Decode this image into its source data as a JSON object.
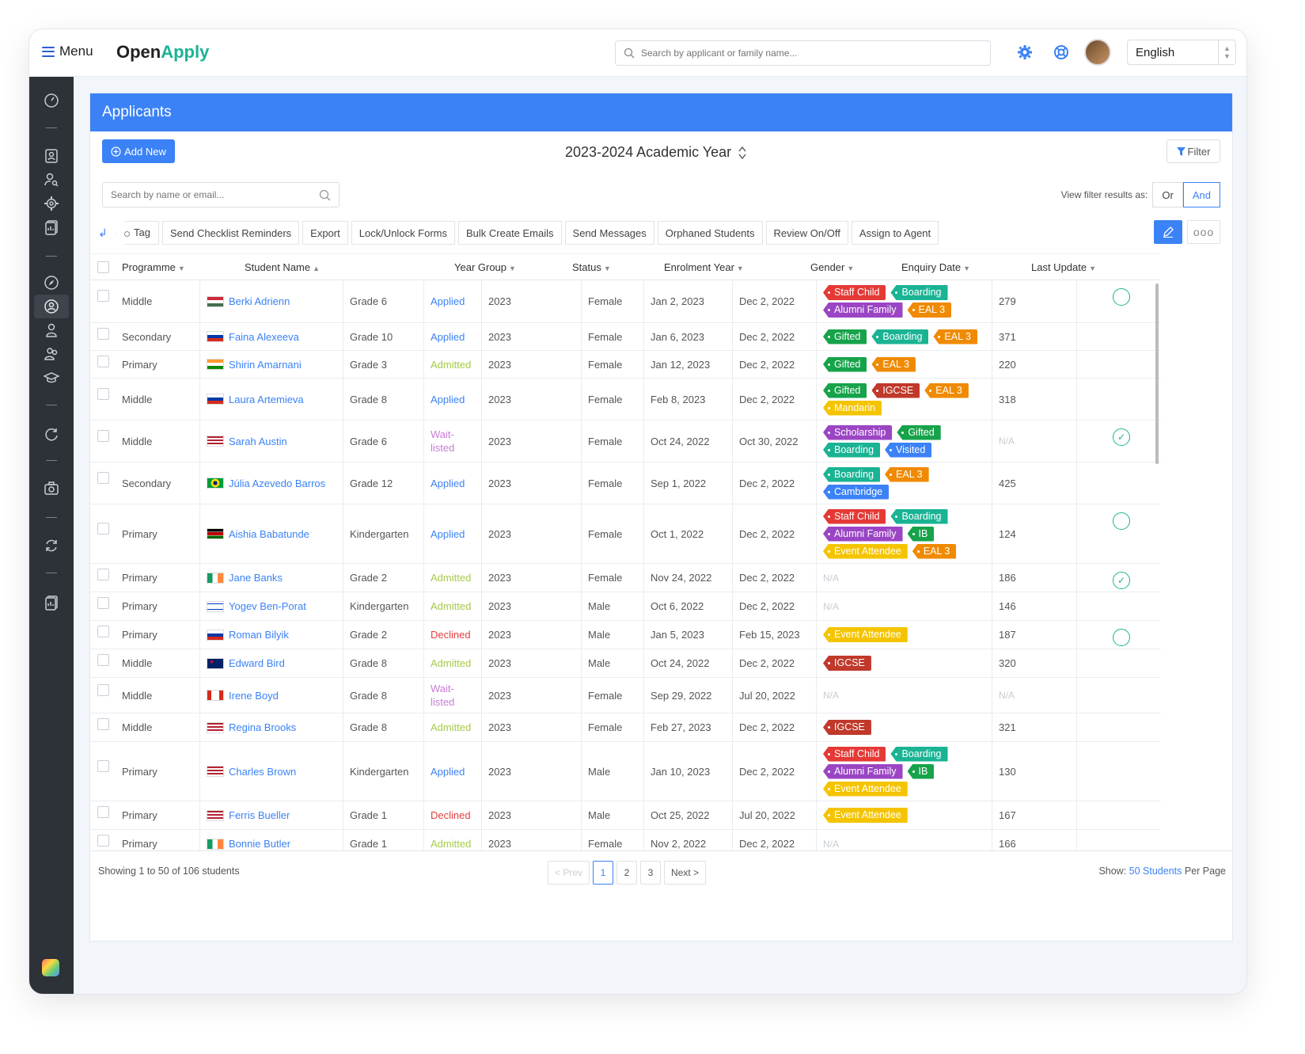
{
  "app": {
    "menu_label": "Menu",
    "logo_part1": "Open",
    "logo_part2": "Apply",
    "search_placeholder": "Search by applicant or family name...",
    "language": "English",
    "icons": [
      "gear-icon",
      "help-icon",
      "avatar"
    ]
  },
  "sidebar": {
    "icons": [
      "dashboard-icon",
      "contacts-icon",
      "user-search-icon",
      "settings-icon",
      "reports-icon",
      "compass-icon",
      "applicants-icon",
      "person-icon",
      "group-icon",
      "graduation-icon",
      "refresh-icon",
      "camera-icon",
      "sync-icon",
      "documents-icon"
    ]
  },
  "page": {
    "title": "Applicants",
    "add_new": "Add New",
    "academic_year": "2023-2024 Academic Year",
    "filter": "Filter",
    "name_search_placeholder": "Search by name or email...",
    "view_filter_label": "View filter results as:",
    "view_or": "Or",
    "view_and": "And"
  },
  "toolbar": {
    "tag": "Tag",
    "buttons": [
      "Send Checklist Reminders",
      "Export",
      "Lock/Unlock Forms",
      "Bulk Create Emails",
      "Send Messages",
      "Orphaned Students",
      "Review On/Off",
      "Assign to Agent"
    ],
    "more": "ooo"
  },
  "columns": [
    "Programme",
    "Student Name",
    "Year Group",
    "Status",
    "Enrolment Year",
    "Gender",
    "Enquiry Date",
    "Last Update"
  ],
  "colors": {
    "accent": "#3b82f6",
    "applied": "#3b82f6",
    "admitted": "#a6c94a",
    "waitlisted": "#c77dd6",
    "declined": "#e53e3e",
    "tag_red": "#e53935",
    "tag_teal": "#1ab394",
    "tag_purple": "#9b45c4",
    "tag_orange": "#f08a00",
    "tag_green": "#16a34a",
    "tag_darkred": "#c0392b",
    "tag_yellow": "#f5c400",
    "tag_blue": "#3b82f6"
  },
  "rows": [
    {
      "programme": "Middle",
      "name": "Berki Adrienn",
      "flag": "hu",
      "grade": "Grade 6",
      "status": "Applied",
      "status_key": "applied",
      "year": "2023",
      "gender": "Female",
      "enquiry": "Jan 2, 2023",
      "last_update": "Dec 2, 2022",
      "tags": [
        {
          "label": "Staff Child",
          "c": "tag_red"
        },
        {
          "label": "Boarding",
          "c": "tag_teal"
        },
        {
          "label": "Alumni Family",
          "c": "tag_purple"
        },
        {
          "label": "EAL 3",
          "c": "tag_orange"
        }
      ],
      "score": "279",
      "check": "empty"
    },
    {
      "programme": "Secondary",
      "name": "Faina Alexeeva",
      "flag": "ru",
      "grade": "Grade 10",
      "status": "Applied",
      "status_key": "applied",
      "year": "2023",
      "gender": "Female",
      "enquiry": "Jan 6, 2023",
      "last_update": "Dec 2, 2022",
      "tags": [
        {
          "label": "Gifted",
          "c": "tag_green"
        },
        {
          "label": "Boarding",
          "c": "tag_teal"
        },
        {
          "label": "EAL 3",
          "c": "tag_orange"
        }
      ],
      "score": "371",
      "check": ""
    },
    {
      "programme": "Primary",
      "name": "Shirin Amarnani",
      "flag": "in",
      "grade": "Grade 3",
      "status": "Admitted",
      "status_key": "admitted",
      "year": "2023",
      "gender": "Female",
      "enquiry": "Jan 12, 2023",
      "last_update": "Dec 2, 2022",
      "tags": [
        {
          "label": "Gifted",
          "c": "tag_green"
        },
        {
          "label": "EAL 3",
          "c": "tag_orange"
        }
      ],
      "score": "220",
      "check": ""
    },
    {
      "programme": "Middle",
      "name": "Laura Artemieva",
      "flag": "ru",
      "grade": "Grade 8",
      "status": "Applied",
      "status_key": "applied",
      "year": "2023",
      "gender": "Female",
      "enquiry": "Feb 8, 2023",
      "last_update": "Dec 2, 2022",
      "tags": [
        {
          "label": "Gifted",
          "c": "tag_green"
        },
        {
          "label": "IGCSE",
          "c": "tag_darkred"
        },
        {
          "label": "EAL 3",
          "c": "tag_orange"
        },
        {
          "label": "Mandarin",
          "c": "tag_yellow"
        }
      ],
      "score": "318",
      "check": ""
    },
    {
      "programme": "Middle",
      "name": "Sarah Austin",
      "flag": "us",
      "grade": "Grade 6",
      "status": "Wait-listed",
      "status_key": "waitlisted",
      "year": "2023",
      "gender": "Female",
      "enquiry": "Oct 24, 2022",
      "last_update": "Oct 30, 2022",
      "tags": [
        {
          "label": "Scholarship",
          "c": "tag_purple"
        },
        {
          "label": "Gifted",
          "c": "tag_green"
        },
        {
          "label": "Boarding",
          "c": "tag_teal"
        },
        {
          "label": "Visited",
          "c": "tag_blue"
        }
      ],
      "score": "N/A",
      "check": "checked"
    },
    {
      "programme": "Secondary",
      "name": "Júlia Azevedo Barros",
      "flag": "br",
      "grade": "Grade 12",
      "status": "Applied",
      "status_key": "applied",
      "year": "2023",
      "gender": "Female",
      "enquiry": "Sep 1, 2022",
      "last_update": "Dec 2, 2022",
      "tags": [
        {
          "label": "Boarding",
          "c": "tag_teal"
        },
        {
          "label": "EAL 3",
          "c": "tag_orange"
        },
        {
          "label": "Cambridge",
          "c": "tag_blue"
        }
      ],
      "score": "425",
      "check": ""
    },
    {
      "programme": "Primary",
      "name": "Aishia Babatunde",
      "flag": "ke",
      "grade": "Kindergarten",
      "status": "Applied",
      "status_key": "applied",
      "year": "2023",
      "gender": "Female",
      "enquiry": "Oct 1, 2022",
      "last_update": "Dec 2, 2022",
      "tags": [
        {
          "label": "Staff Child",
          "c": "tag_red"
        },
        {
          "label": "Boarding",
          "c": "tag_teal"
        },
        {
          "label": "Alumni Family",
          "c": "tag_purple"
        },
        {
          "label": "IB",
          "c": "tag_green"
        },
        {
          "label": "Event Attendee",
          "c": "tag_yellow"
        },
        {
          "label": "EAL 3",
          "c": "tag_orange"
        }
      ],
      "score": "124",
      "check": "empty"
    },
    {
      "programme": "Primary",
      "name": "Jane Banks",
      "flag": "ie",
      "grade": "Grade 2",
      "status": "Admitted",
      "status_key": "admitted",
      "year": "2023",
      "gender": "Female",
      "enquiry": "Nov 24, 2022",
      "last_update": "Dec 2, 2022",
      "tags": [],
      "score": "186",
      "check": "checked"
    },
    {
      "programme": "Primary",
      "name": "Yogev Ben-Porat",
      "flag": "il",
      "grade": "Kindergarten",
      "status": "Admitted",
      "status_key": "admitted",
      "year": "2023",
      "gender": "Male",
      "enquiry": "Oct 6, 2022",
      "last_update": "Dec 2, 2022",
      "tags": [],
      "score": "146",
      "check": ""
    },
    {
      "programme": "Primary",
      "name": "Roman Bilyik",
      "flag": "ru",
      "grade": "Grade 2",
      "status": "Declined",
      "status_key": "declined",
      "year": "2023",
      "gender": "Male",
      "enquiry": "Jan 5, 2023",
      "last_update": "Feb 15, 2023",
      "tags": [
        {
          "label": "Event Attendee",
          "c": "tag_yellow"
        }
      ],
      "score": "187",
      "check": "empty"
    },
    {
      "programme": "Middle",
      "name": "Edward Bird",
      "flag": "au",
      "grade": "Grade 8",
      "status": "Admitted",
      "status_key": "admitted",
      "year": "2023",
      "gender": "Male",
      "enquiry": "Oct 24, 2022",
      "last_update": "Dec 2, 2022",
      "tags": [
        {
          "label": "IGCSE",
          "c": "tag_darkred"
        }
      ],
      "score": "320",
      "check": ""
    },
    {
      "programme": "Middle",
      "name": "Irene Boyd",
      "flag": "ca",
      "grade": "Grade 8",
      "status": "Wait-listed",
      "status_key": "waitlisted",
      "year": "2023",
      "gender": "Female",
      "enquiry": "Sep 29, 2022",
      "last_update": "Jul 20, 2022",
      "tags": [],
      "score": "N/A",
      "check": ""
    },
    {
      "programme": "Middle",
      "name": "Regina Brooks",
      "flag": "us",
      "grade": "Grade 8",
      "status": "Admitted",
      "status_key": "admitted",
      "year": "2023",
      "gender": "Female",
      "enquiry": "Feb 27, 2023",
      "last_update": "Dec 2, 2022",
      "tags": [
        {
          "label": "IGCSE",
          "c": "tag_darkred"
        }
      ],
      "score": "321",
      "check": ""
    },
    {
      "programme": "Primary",
      "name": "Charles Brown",
      "flag": "us",
      "grade": "Kindergarten",
      "status": "Applied",
      "status_key": "applied",
      "year": "2023",
      "gender": "Male",
      "enquiry": "Jan 10, 2023",
      "last_update": "Dec 2, 2022",
      "tags": [
        {
          "label": "Staff Child",
          "c": "tag_red"
        },
        {
          "label": "Boarding",
          "c": "tag_teal"
        },
        {
          "label": "Alumni Family",
          "c": "tag_purple"
        },
        {
          "label": "IB",
          "c": "tag_green"
        },
        {
          "label": "Event Attendee",
          "c": "tag_yellow"
        }
      ],
      "score": "130",
      "check": ""
    },
    {
      "programme": "Primary",
      "name": "Ferris Bueller",
      "flag": "us",
      "grade": "Grade 1",
      "status": "Declined",
      "status_key": "declined",
      "year": "2023",
      "gender": "Male",
      "enquiry": "Oct 25, 2022",
      "last_update": "Jul 20, 2022",
      "tags": [
        {
          "label": "Event Attendee",
          "c": "tag_yellow"
        }
      ],
      "score": "167",
      "check": ""
    },
    {
      "programme": "Primary",
      "name": "Bonnie Butler",
      "flag": "ie",
      "grade": "Grade 1",
      "status": "Admitted",
      "status_key": "admitted",
      "year": "2023",
      "gender": "Female",
      "enquiry": "Nov 2, 2022",
      "last_update": "Dec 2, 2022",
      "tags": [],
      "score": "166",
      "check": ""
    }
  ],
  "na_label": "N/A",
  "footer": {
    "showing": "Showing 1 to 50 of 106 students",
    "prev": "< Prev",
    "pages": [
      "1",
      "2",
      "3"
    ],
    "next": "Next >",
    "show_label": "Show:",
    "per_page_link": "50 Students",
    "per_page_suffix": "Per Page"
  }
}
